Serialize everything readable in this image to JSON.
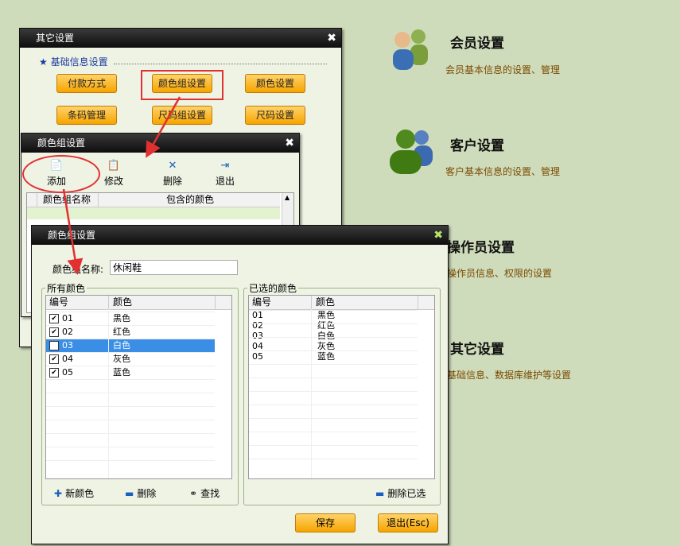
{
  "menu": [
    {
      "title": "会员设置",
      "desc": "会员基本信息的设置、管理",
      "icon": "members-icon"
    },
    {
      "title": "客户设置",
      "desc": "客户基本信息的设置、管理",
      "icon": "customer-icon"
    },
    {
      "title": "操作员设置",
      "desc": "操作员信息、权限的设置",
      "icon": "operator-icon"
    },
    {
      "title": "其它设置",
      "desc": "基础信息、数据库维护等设置",
      "icon": "other-icon"
    }
  ],
  "other_settings": {
    "title": "其它设置",
    "section": "基础信息设置",
    "buttons": [
      "付款方式",
      "颜色组设置",
      "颜色设置",
      "条码管理",
      "尺码组设置",
      "尺码设置"
    ]
  },
  "color_group_list": {
    "title": "颜色组设置",
    "toolbar": [
      "添加",
      "修改",
      "删除",
      "退出"
    ],
    "columns": [
      "颜色组名称",
      "包含的颜色"
    ]
  },
  "color_group_edit": {
    "title": "颜色组设置",
    "name_label": "颜色组名称:",
    "name_value": "休闲鞋",
    "all_colors": {
      "legend": "所有颜色",
      "columns": [
        "编号",
        "颜色"
      ],
      "rows": [
        [
          "01",
          "黑色"
        ],
        [
          "02",
          "红色"
        ],
        [
          "03",
          "白色"
        ],
        [
          "04",
          "灰色"
        ],
        [
          "05",
          "蓝色"
        ]
      ],
      "selected_row": 2
    },
    "chosen_colors": {
      "legend": "已选的颜色",
      "columns": [
        "编号",
        "颜色"
      ],
      "rows": [
        [
          "01",
          "黑色"
        ],
        [
          "02",
          "红色"
        ],
        [
          "03",
          "白色"
        ],
        [
          "04",
          "灰色"
        ],
        [
          "05",
          "蓝色"
        ]
      ]
    },
    "left_tools": [
      "新颜色",
      "删除",
      "查找"
    ],
    "right_tool": "删除已选",
    "save": "保存",
    "exit": "退出(Esc)"
  },
  "colors": {
    "accent": "#f6a400",
    "highlight": "#3a8ee6",
    "annotation": "#e23030"
  }
}
